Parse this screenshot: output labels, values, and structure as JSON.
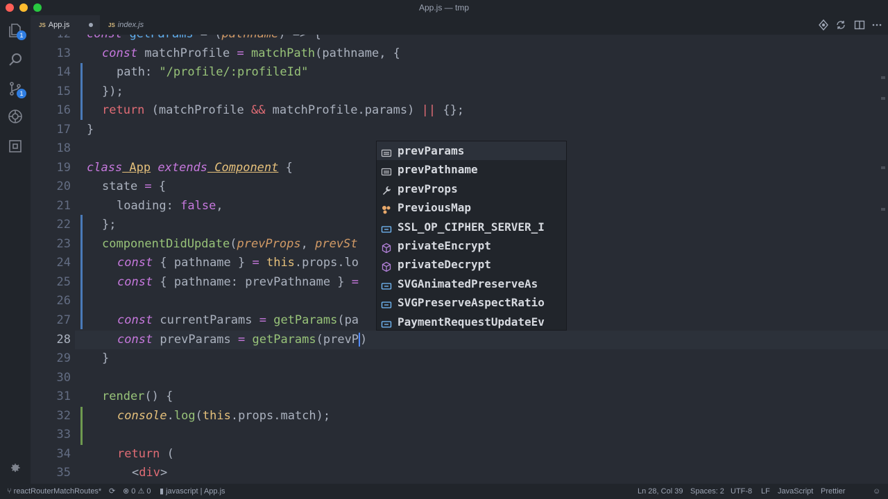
{
  "window": {
    "title": "App.js — tmp"
  },
  "activity_bar": {
    "items": [
      {
        "name": "explorer",
        "badge": "1"
      },
      {
        "name": "search",
        "badge": ""
      },
      {
        "name": "source-control",
        "badge": "1"
      },
      {
        "name": "debug",
        "badge": ""
      },
      {
        "name": "extensions",
        "badge": ""
      }
    ]
  },
  "tabs": [
    {
      "label": "App.js",
      "icon": "JS",
      "active": true,
      "dirty": true
    },
    {
      "label": "index.js",
      "icon": "JS",
      "active": false,
      "dirty": false
    }
  ],
  "editor": {
    "lines": [
      {
        "n": "12"
      },
      {
        "n": "13"
      },
      {
        "n": "14"
      },
      {
        "n": "15"
      },
      {
        "n": "16"
      },
      {
        "n": "17"
      },
      {
        "n": "18"
      },
      {
        "n": "19"
      },
      {
        "n": "20"
      },
      {
        "n": "21"
      },
      {
        "n": "22"
      },
      {
        "n": "23"
      },
      {
        "n": "24"
      },
      {
        "n": "25"
      },
      {
        "n": "26"
      },
      {
        "n": "27"
      },
      {
        "n": "28"
      },
      {
        "n": "29"
      },
      {
        "n": "30"
      },
      {
        "n": "31"
      },
      {
        "n": "32"
      },
      {
        "n": "33"
      },
      {
        "n": "34"
      },
      {
        "n": "35"
      }
    ],
    "code": {
      "l12_a": "const",
      "l12_b": "getParams",
      "l12_c": " = (",
      "l12_d": "pathname",
      "l12_e": ") => {",
      "l13_a": "const",
      "l13_b": " matchProfile ",
      "l13_c": "=",
      "l13_d": " matchPath",
      "l13_e": "(pathname, {",
      "l14_a": "path: ",
      "l14_b": "\"/profile/:profileId\"",
      "l15_a": "});",
      "l16_a": "return",
      "l16_b": " (matchProfile ",
      "l16_c": "&&",
      "l16_d": " matchProfile.params) ",
      "l16_e": "||",
      "l16_f": " {};",
      "l17_a": "}",
      "l19_a": "class",
      "l19_b": " App",
      "l19_c": " extends",
      "l19_d": " Component",
      "l19_e": " {",
      "l20_a": "state ",
      "l20_b": "=",
      "l20_c": " {",
      "l21_a": "loading: ",
      "l21_b": "false",
      "l21_c": ",",
      "l22_a": "};",
      "l23_a": "componentDidUpdate",
      "l23_b": "(",
      "l23_c": "prevProps",
      "l23_d": ", ",
      "l23_e": "prevSt",
      "l24_a": "const",
      "l24_b": " { pathname } ",
      "l24_c": "=",
      "l24_d": " this",
      "l24_e": ".props.lo",
      "l25_a": "const",
      "l25_b": " { pathname: prevPathname } ",
      "l25_c": "=",
      "l27_a": "const",
      "l27_b": " currentParams ",
      "l27_c": "=",
      "l27_d": " getParams",
      "l27_e": "(pa",
      "l28_a": "const",
      "l28_b": " prevParams ",
      "l28_c": "=",
      "l28_d": " getParams",
      "l28_e": "(prevP",
      "l28_f": ")",
      "l29_a": "}",
      "l31_a": "render",
      "l31_b": "() {",
      "l32_a": "console",
      "l32_b": ".",
      "l32_c": "log",
      "l32_d": "(",
      "l32_e": "this",
      "l32_f": ".props.match);",
      "l34_a": "return",
      "l34_b": " (",
      "l35_a": "<",
      "l35_b": "div",
      "l35_c": ">"
    }
  },
  "suggestions": [
    {
      "label": "prevParams",
      "icon": "variable-icon",
      "selected": true
    },
    {
      "label": "prevPathname",
      "icon": "variable-icon",
      "selected": false
    },
    {
      "label": "prevProps",
      "icon": "wrench-icon",
      "selected": false
    },
    {
      "label": "PreviousMap",
      "icon": "class-icon",
      "selected": false
    },
    {
      "label": "SSL_OP_CIPHER_SERVER_I",
      "icon": "constant-icon",
      "selected": false
    },
    {
      "label": "privateEncrypt",
      "icon": "method-icon",
      "selected": false
    },
    {
      "label": "privateDecrypt",
      "icon": "method-icon",
      "selected": false
    },
    {
      "label": "SVGAnimatedPreserveAs",
      "icon": "constant-icon",
      "selected": false
    },
    {
      "label": "SVGPreserveAspectRatio",
      "icon": "constant-icon",
      "selected": false
    },
    {
      "label": "PaymentRequestUpdateEv",
      "icon": "constant-icon",
      "selected": false
    }
  ],
  "statusbar": {
    "branch": "reactRouterMatchRoutes*",
    "errors": "0",
    "warnings": "0",
    "language_scope": "javascript",
    "file": "App.js",
    "position": "Ln 28, Col 39",
    "spaces": "Spaces: 2",
    "encoding": "UTF-8",
    "eol": "LF",
    "language": "JavaScript",
    "formatter": "Prettier"
  },
  "colors": {
    "background": "#282c34",
    "keyword": "#c678dd",
    "function": "#61afef",
    "string": "#98c379",
    "type": "#e5c07b",
    "param": "#d19a66"
  }
}
